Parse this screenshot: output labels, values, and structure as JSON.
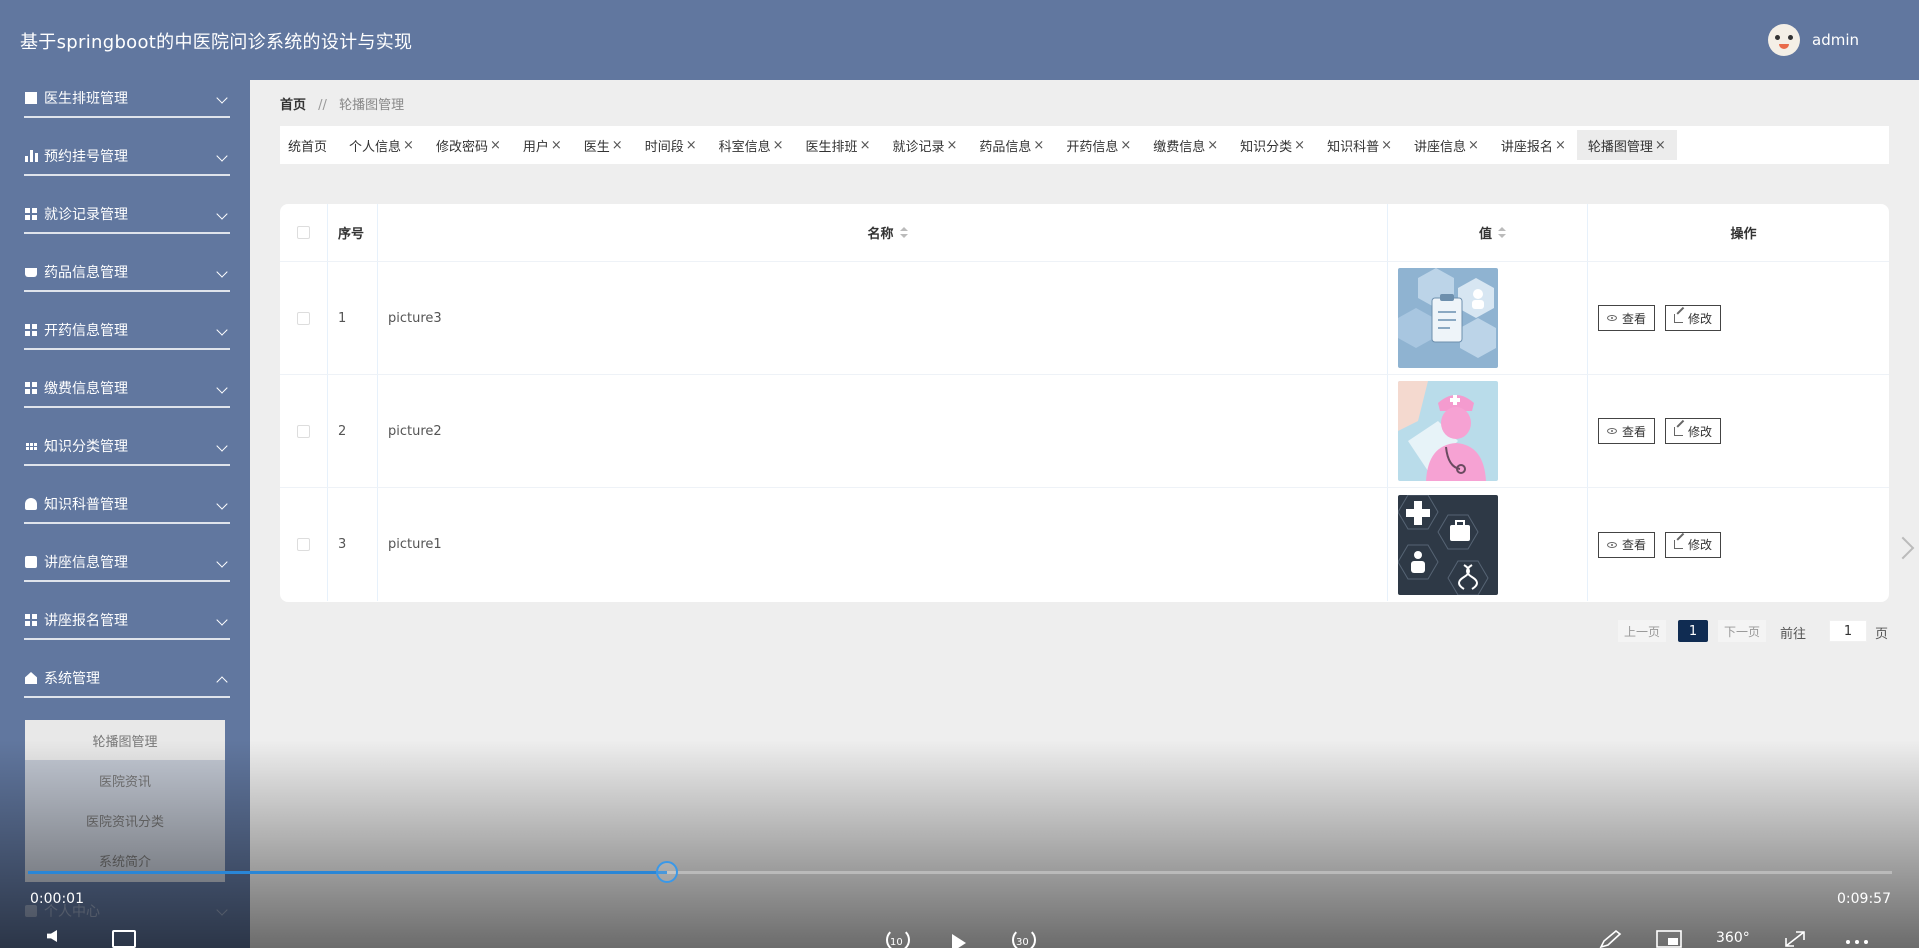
{
  "header": {
    "title": "基于springboot的中医院问诊系统的设计与实现",
    "username": "admin"
  },
  "sidebar": {
    "items": [
      {
        "label": "医生排班管理",
        "icon": "chart-line-icon"
      },
      {
        "label": "预约挂号管理",
        "icon": "bar-chart-icon"
      },
      {
        "label": "就诊记录管理",
        "icon": "grid-icon"
      },
      {
        "label": "药品信息管理",
        "icon": "cup-icon"
      },
      {
        "label": "开药信息管理",
        "icon": "grid-icon"
      },
      {
        "label": "缴费信息管理",
        "icon": "grid-icon"
      },
      {
        "label": "知识分类管理",
        "icon": "table-icon"
      },
      {
        "label": "知识科普管理",
        "icon": "user-icon"
      },
      {
        "label": "讲座信息管理",
        "icon": "checklist-icon"
      },
      {
        "label": "讲座报名管理",
        "icon": "grid-icon"
      },
      {
        "label": "系统管理",
        "icon": "house-icon"
      }
    ],
    "submenu": [
      "轮播图管理",
      "医院资讯",
      "医院资讯分类",
      "系统简介"
    ],
    "hidden_item": "个人中心"
  },
  "breadcrumb": {
    "home": "首页",
    "separator": "//",
    "current": "轮播图管理"
  },
  "tabs": [
    {
      "label": "统首页",
      "closable": false
    },
    {
      "label": "个人信息",
      "closable": true
    },
    {
      "label": "修改密码",
      "closable": true
    },
    {
      "label": "用户",
      "closable": true
    },
    {
      "label": "医生",
      "closable": true
    },
    {
      "label": "时间段",
      "closable": true
    },
    {
      "label": "科室信息",
      "closable": true
    },
    {
      "label": "医生排班",
      "closable": true
    },
    {
      "label": "就诊记录",
      "closable": true
    },
    {
      "label": "药品信息",
      "closable": true
    },
    {
      "label": "开药信息",
      "closable": true
    },
    {
      "label": "缴费信息",
      "closable": true
    },
    {
      "label": "知识分类",
      "closable": true
    },
    {
      "label": "知识科普",
      "closable": true
    },
    {
      "label": "讲座信息",
      "closable": true
    },
    {
      "label": "讲座报名",
      "closable": true
    },
    {
      "label": "轮播图管理",
      "closable": true,
      "active": true
    }
  ],
  "close_glyph": "×",
  "table": {
    "headers": {
      "no": "序号",
      "name": "名称",
      "value": "值",
      "ops": "操作"
    },
    "rows": [
      {
        "no": "1",
        "name": "picture3",
        "thumb": "medical-clipboard-hexagon-image"
      },
      {
        "no": "2",
        "name": "picture2",
        "thumb": "nurse-avatar-image"
      },
      {
        "no": "3",
        "name": "picture1",
        "thumb": "medical-icons-dark-image"
      }
    ],
    "view_label": "查看",
    "edit_label": "修改"
  },
  "pager": {
    "prev": "上一页",
    "current": "1",
    "next": "下一页",
    "goto": "前往",
    "goto_value": "1",
    "page_unit": "页"
  },
  "player": {
    "current_time": "0:00:01",
    "duration": "0:09:57",
    "progress_fraction": 0.343,
    "skip_back": "10",
    "skip_fwd": "30",
    "vr_label": "360°",
    "accent": "#2a86d6"
  },
  "colors": {
    "header_bg": "#61779f",
    "active_page": "#102c52"
  }
}
